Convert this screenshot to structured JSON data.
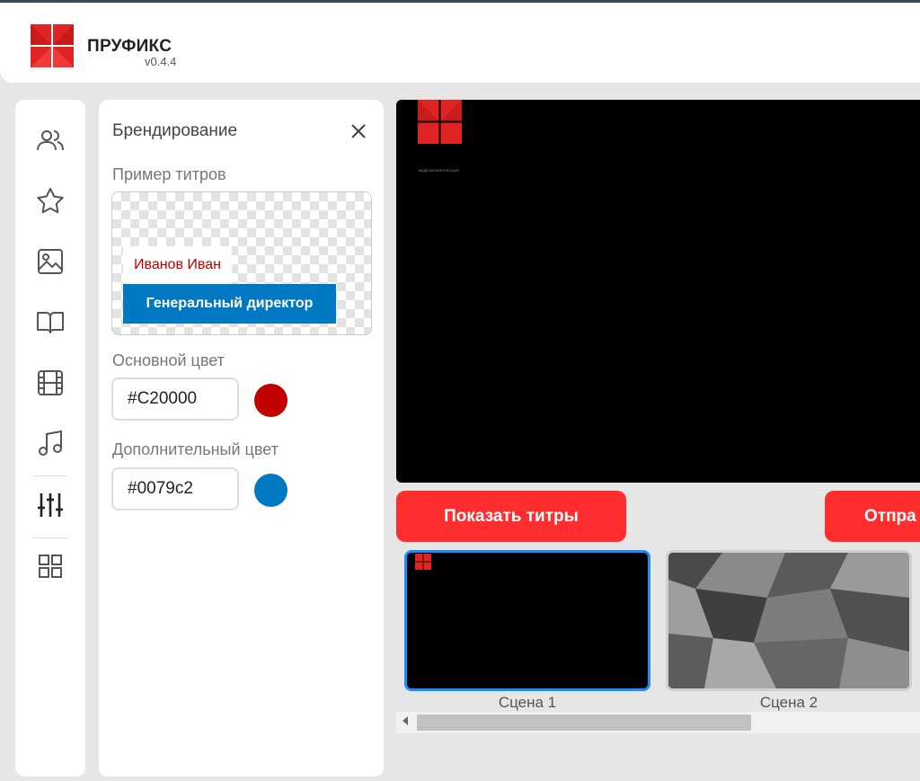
{
  "app": {
    "name": "ПРУФИКС",
    "version": "v0.4.4"
  },
  "sidebar_icons": [
    "users-icon",
    "star-icon",
    "image-icon",
    "book-icon",
    "film-icon",
    "music-icon",
    "sliders-icon",
    "grid-icon"
  ],
  "panel": {
    "title": "Брендирование",
    "example_label": "Пример титров",
    "sample_name": "Иванов Иван",
    "sample_position": "Генеральный директор",
    "primary_label": "Основной цвет",
    "primary_color": "#C20000",
    "secondary_label": "Дополнительный цвет",
    "secondary_color": "#0079c2"
  },
  "stage": {
    "caption": "ВИДЕОКОНФЕРЕНЦИИ"
  },
  "buttons": {
    "show_titles": "Показать титры",
    "send": "Отпра"
  },
  "scenes": [
    {
      "label": "Сцена 1",
      "selected": true
    },
    {
      "label": "Сцена 2",
      "selected": false
    }
  ],
  "colors": {
    "accent_red": "#ff2d2d",
    "selection_blue": "#1a8cff"
  }
}
